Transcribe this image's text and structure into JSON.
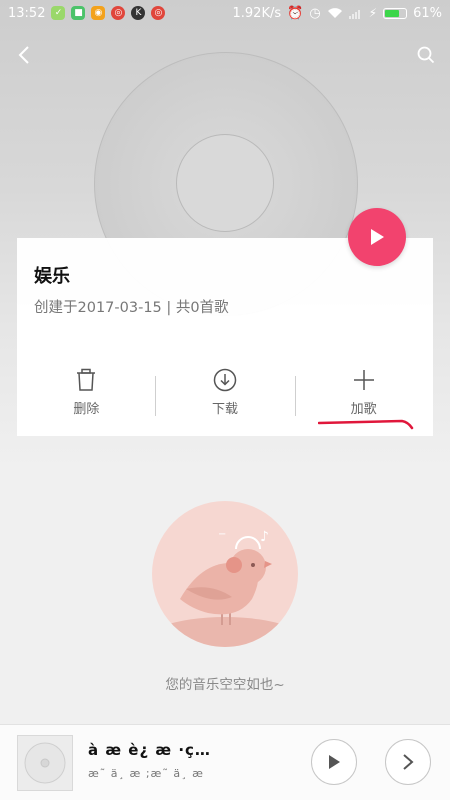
{
  "status_bar": {
    "time": "13:52",
    "net_speed": "1.92K/s",
    "battery": "61%",
    "battery_level": 0.61
  },
  "colors": {
    "accent": "#f2436e",
    "annotation": "#e0173b"
  },
  "playlist": {
    "title": "娱乐",
    "meta": "创建于2017-03-15 | 共0首歌"
  },
  "actions": {
    "delete": "删除",
    "download": "下载",
    "add_song": "加歌"
  },
  "empty_state": {
    "text": "您的音乐空空如也~"
  },
  "mini_player": {
    "title": "à    æ    è¿  æ ·ç…",
    "subtitle": "æ˜  ä¸  æ    ;æ˜  ä¸  æ"
  },
  "icons": [
    "back-icon",
    "search-icon",
    "play-icon",
    "trash-icon",
    "download-icon",
    "plus-icon",
    "next-icon"
  ]
}
